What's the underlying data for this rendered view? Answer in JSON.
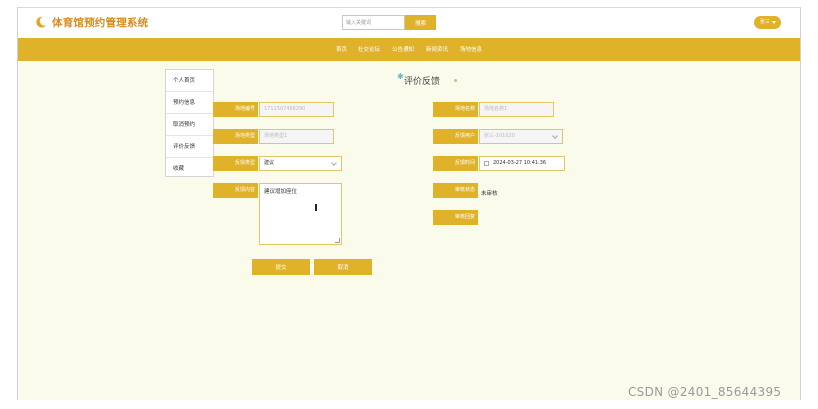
{
  "header": {
    "site_title": "体育馆预约管理系统",
    "search_placeholder": "输入关键词",
    "search_button": "搜索",
    "user_name": "张三"
  },
  "nav": {
    "items": [
      "首页",
      "社交论坛",
      "公告通知",
      "新闻资讯",
      "场地信息"
    ]
  },
  "side_menu": {
    "items": [
      "个人首页",
      "预约信息",
      "取消预约",
      "评价反馈",
      "收藏"
    ]
  },
  "page": {
    "heading": "评价反馈"
  },
  "form": {
    "venue_number_label": "场地编号",
    "venue_number_value": "1711507468290",
    "venue_name_label": "场地名称",
    "venue_name_value": "场地名称1",
    "venue_type_label": "场地类型",
    "venue_type_value": "场地类型1",
    "user_label": "反馈用户",
    "user_value": "张三-101020",
    "feedback_type_label": "反馈类型",
    "feedback_type_value": "建议",
    "feedback_time_label": "反馈时间",
    "feedback_time_value": "2024-03-27 10:41:36",
    "feedback_content_label": "反馈内容",
    "feedback_content_value": "建议增加座位",
    "reply_status_label": "审核状态",
    "reply_status_value": "未审核",
    "reply_label": "审核回复"
  },
  "actions": {
    "submit": "提交",
    "cancel": "取消"
  },
  "watermark": "CSDN @2401_85644395",
  "colors": {
    "accent": "#e0b22a",
    "page_bg": "#fbfbec",
    "title": "#d98c1e"
  }
}
